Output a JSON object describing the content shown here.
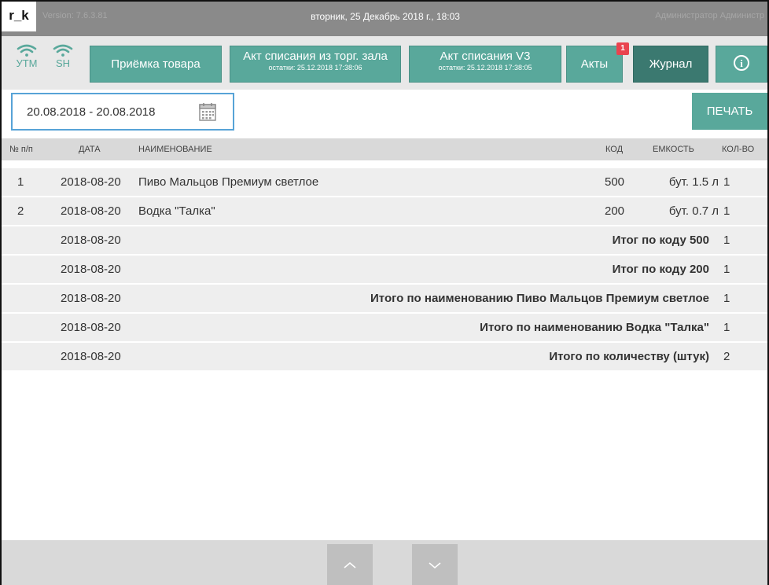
{
  "titlebar": {
    "logo": "r_k",
    "version": "Version: 7.6.3.81",
    "datetime": "вторник, 25 Декабрь 2018 г., 18:03",
    "user": "Администратор Администр"
  },
  "status": {
    "utm_label": "УТМ",
    "sh_label": "SH",
    "accent_color": "#59a89b"
  },
  "toolbar": {
    "receipt_label": "Приёмка товара",
    "writeoff_hall_label": "Акт списания из торг. зала",
    "writeoff_hall_sub": "остатки: 25.12.2018 17:38:06",
    "writeoff_v3_label": "Акт списания V3",
    "writeoff_v3_sub": "остатки: 25.12.2018 17:38:05",
    "acts_label": "Акты",
    "acts_badge": "1",
    "journal_label": "Журнал",
    "info_glyph": "i"
  },
  "filter": {
    "date_range": "20.08.2018 - 20.08.2018",
    "print_label": "ПЕЧАТЬ"
  },
  "table": {
    "headers": {
      "num": "№ п/п",
      "date": "ДАТА",
      "name": "НАИМЕНОВАНИЕ",
      "code": "КОД",
      "capacity": "ЕМКОСТЬ",
      "qty": "КОЛ-ВО"
    },
    "items": [
      {
        "num": "1",
        "date": "2018-08-20",
        "name": "Пиво Мальцов Премиум светлое",
        "code": "500",
        "capacity": "бут. 1.5 л",
        "qty": "1"
      },
      {
        "num": "2",
        "date": "2018-08-20",
        "name": "Водка \"Талка\"",
        "code": "200",
        "capacity": "бут. 0.7 л",
        "qty": "1"
      }
    ],
    "totals": [
      {
        "date": "2018-08-20",
        "label": "Итог по коду 500",
        "qty": "1"
      },
      {
        "date": "2018-08-20",
        "label": "Итог по коду 200",
        "qty": "1"
      },
      {
        "date": "2018-08-20",
        "label": "Итого по наименованию Пиво Мальцов Премиум светлое",
        "qty": "1"
      },
      {
        "date": "2018-08-20",
        "label": "Итого по наименованию Водка \"Талка\"",
        "qty": "1"
      },
      {
        "date": "2018-08-20",
        "label": "Итого по количеству (штук)",
        "qty": "2"
      }
    ]
  },
  "icons": {
    "wifi": "wifi-icon",
    "calendar": "calendar-icon",
    "info": "info-icon",
    "up": "chevron-up-icon",
    "down": "chevron-down-icon"
  }
}
